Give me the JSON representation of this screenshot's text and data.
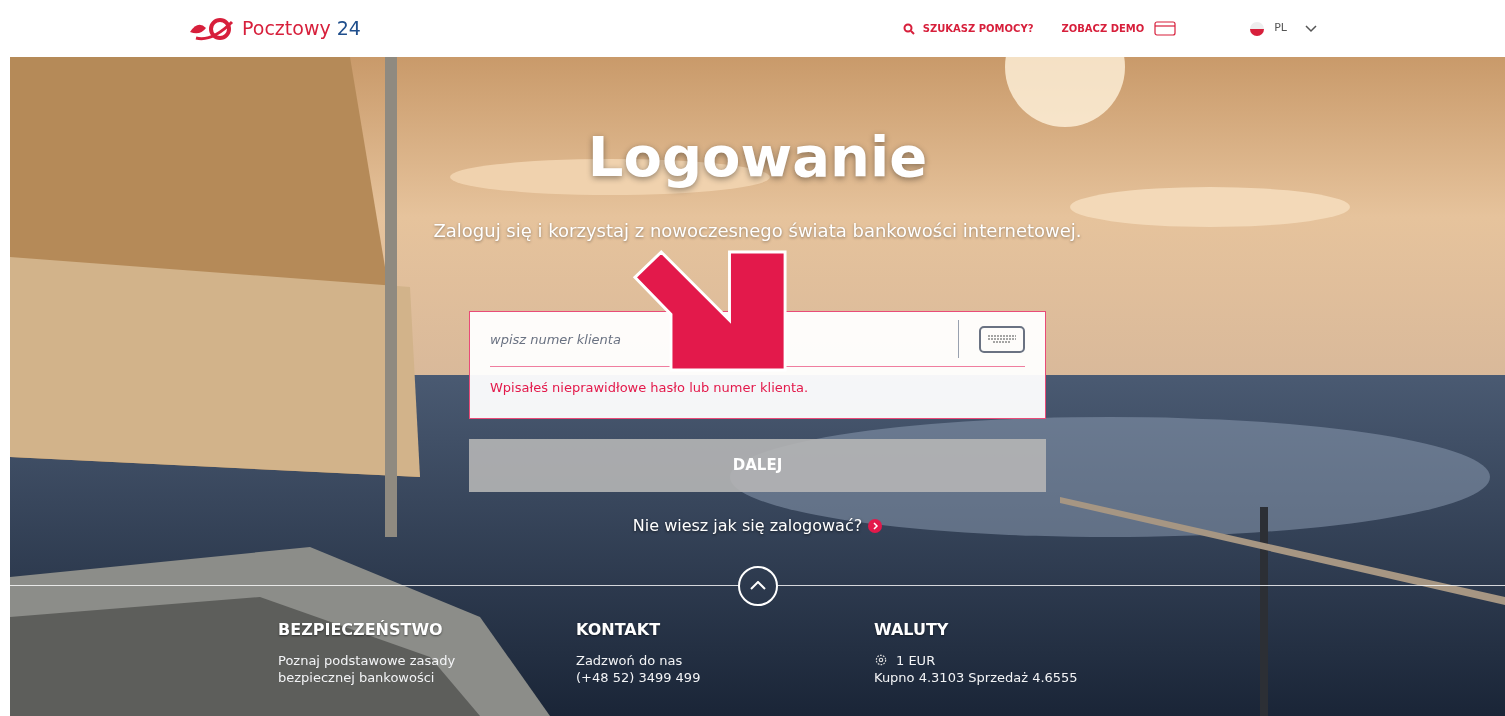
{
  "header": {
    "logo_text": "Pocztowy",
    "logo_number": "24",
    "help_link": "SZUKASZ POMOCY?",
    "demo_link": "ZOBACZ DEMO",
    "language": "PL"
  },
  "hero": {
    "title": "Logowanie",
    "subtitle": "Zaloguj się i korzystaj z nowoczesnego świata bankowości internetowej."
  },
  "login_form": {
    "client_number_field": {
      "placeholder": "wpisz numer klienta",
      "error": true
    },
    "error_message": "Wpisałeś nieprawidłowe hasło lub numer klienta.",
    "submit_button": {
      "label": "DALEJ",
      "disabled": true
    },
    "help_link": "Nie wiesz jak się zalogować?"
  },
  "footer": {
    "columns": [
      {
        "kind": "text",
        "title": "BEZPIECZEŃSTWO",
        "lines": [
          "Poznaj podstawowe zasady",
          "bezpiecznej bankowości"
        ]
      },
      {
        "kind": "text",
        "title": "KONTAKT",
        "lines": [
          "Zadzwoń do nas",
          "(+48 52) 3499 499"
        ]
      },
      {
        "kind": "currency",
        "title": "WALUTY",
        "lines": [
          "1 EUR",
          "Kupno 4.3103 Sprzedaż 4.6555"
        ]
      }
    ]
  }
}
